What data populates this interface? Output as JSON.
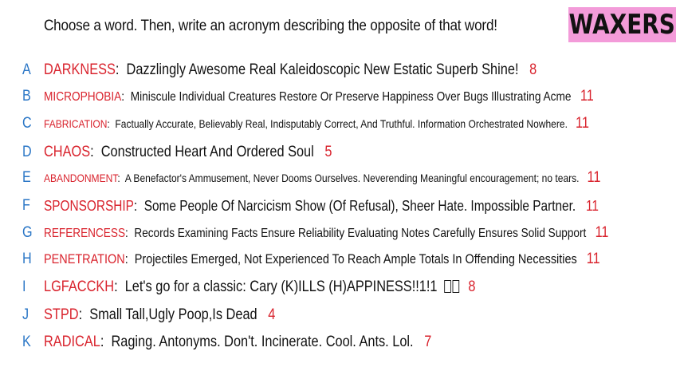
{
  "prompt": "Choose a word. Then, write an acronym describing the opposite of that word!",
  "logo": "WAXERS",
  "colors": {
    "letter": "#2a76c6",
    "word": "#d9232d",
    "number": "#d9232d",
    "logo_bg": "#f39bd9"
  },
  "entries": [
    {
      "letter": "A",
      "word": "DARKNESS",
      "definition": "Dazzlingly Awesome Real Kaleidoscopic New Estatic Superb Shine!",
      "count": "8"
    },
    {
      "letter": "B",
      "word": "MICROPHOBIA",
      "definition": "Miniscule Individual Creatures Restore Or Preserve Happiness Over Bugs Illustrating Acme",
      "count": "11"
    },
    {
      "letter": "C",
      "word": "FABRICATION",
      "definition": "Factually Accurate, Believably Real, Indisputably Correct, And Truthful. Information Orchestrated Nowhere.",
      "count": "11"
    },
    {
      "letter": "D",
      "word": "CHAOS",
      "definition": "Constructed Heart And Ordered Soul",
      "count": "5"
    },
    {
      "letter": "E",
      "word": "ABANDONMENT",
      "definition": "A Benefactor's Ammusement, Never Dooms Ourselves. Neverending Meaningful encouragement; no tears.",
      "count": "11"
    },
    {
      "letter": "F",
      "word": "SPONSORSHIP",
      "definition": "Some People Of Narcicism Show (Of Refusal), Sheer Hate. Impossible Partner.",
      "count": "11"
    },
    {
      "letter": "G",
      "word": "REFERENCESS",
      "definition": "Records Examining Facts Ensure Reliability Evaluating Notes Carefully Ensures Solid Support",
      "count": "11"
    },
    {
      "letter": "H",
      "word": "PENETRATION",
      "definition": "Projectiles Emerged, Not Experienced To Reach Ample Totals In Offending Necessities",
      "count": "11"
    },
    {
      "letter": "I",
      "word": "LGFACCKH",
      "definition": "Let's go for a classic: Cary (K)ILLS (H)APPINESS!!1!1",
      "count": "8"
    },
    {
      "letter": "J",
      "word": "STPD",
      "definition": "Small Tall,Ugly Poop,Is Dead",
      "count": "4"
    },
    {
      "letter": "K",
      "word": "RADICAL",
      "definition": "Raging. Antonyms. Don't. Incinerate. Cool. Ants. Lol.",
      "count": "7"
    }
  ]
}
